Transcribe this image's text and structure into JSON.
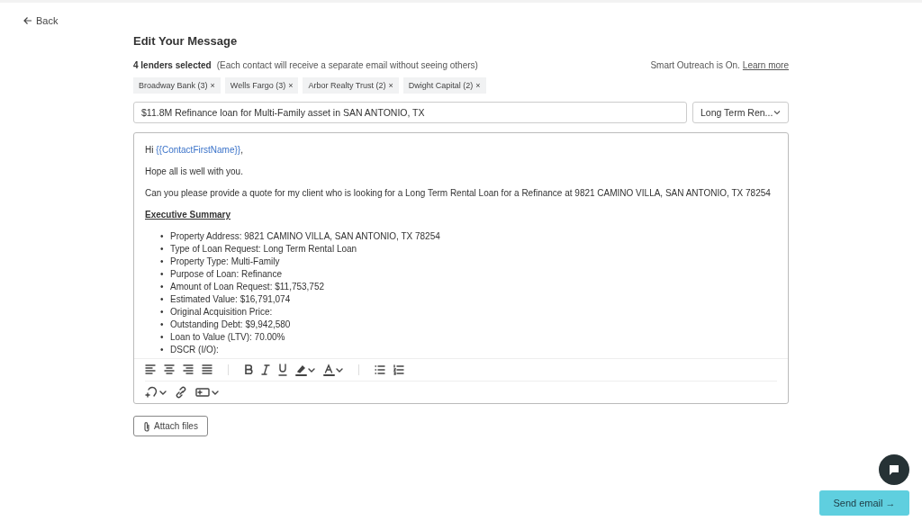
{
  "back": {
    "label": "Back"
  },
  "title": "Edit Your Message",
  "selection": {
    "count": "4 lenders selected",
    "note": "(Each contact will receive a separate email without seeing others)",
    "smart_outreach": "Smart Outreach is On.",
    "link": "Learn more"
  },
  "chips": [
    {
      "label": "Broadway Bank (3)",
      "remove": "×"
    },
    {
      "label": "Wells Fargo (3)",
      "remove": "×"
    },
    {
      "label": "Arbor Realty Trust (2)",
      "remove": "×"
    },
    {
      "label": "Dwight Capital (2)",
      "remove": "×"
    }
  ],
  "subject": {
    "value": "$11.8M Refinance loan for Multi-Family asset in SAN ANTONIO, TX"
  },
  "template_select": {
    "value": "Long Term Ren..."
  },
  "editor": {
    "greeting": {
      "text": "Hi ",
      "variable": "{{ContactFirstName}}",
      "end": ","
    },
    "paragraphs": [
      "Hope all is well with you.",
      "Can you please provide a quote for my client who is looking for a Long Term Rental Loan for a Refinance at 9821 CAMINO VILLA, SAN ANTONIO, TX 78254"
    ],
    "heading": "Executive Summary",
    "bullet_marker": "•",
    "bullets": [
      "Property Address: 9821 CAMINO VILLA, SAN ANTONIO, TX 78254",
      "Type of Loan Request: Long Term Rental Loan",
      "Property Type: Multi-Family",
      "Purpose of Loan: Refinance",
      "Amount of Loan Request: $11,753,752",
      "Estimated Value: $16,791,074",
      "Original Acquisition Price:",
      "Outstanding Debt: $9,942,580",
      "Loan to Value (LTV): 70.00%",
      "DSCR (I/O):"
    ]
  },
  "attach": {
    "label": "Attach files"
  },
  "send": {
    "label": "Send email →"
  }
}
